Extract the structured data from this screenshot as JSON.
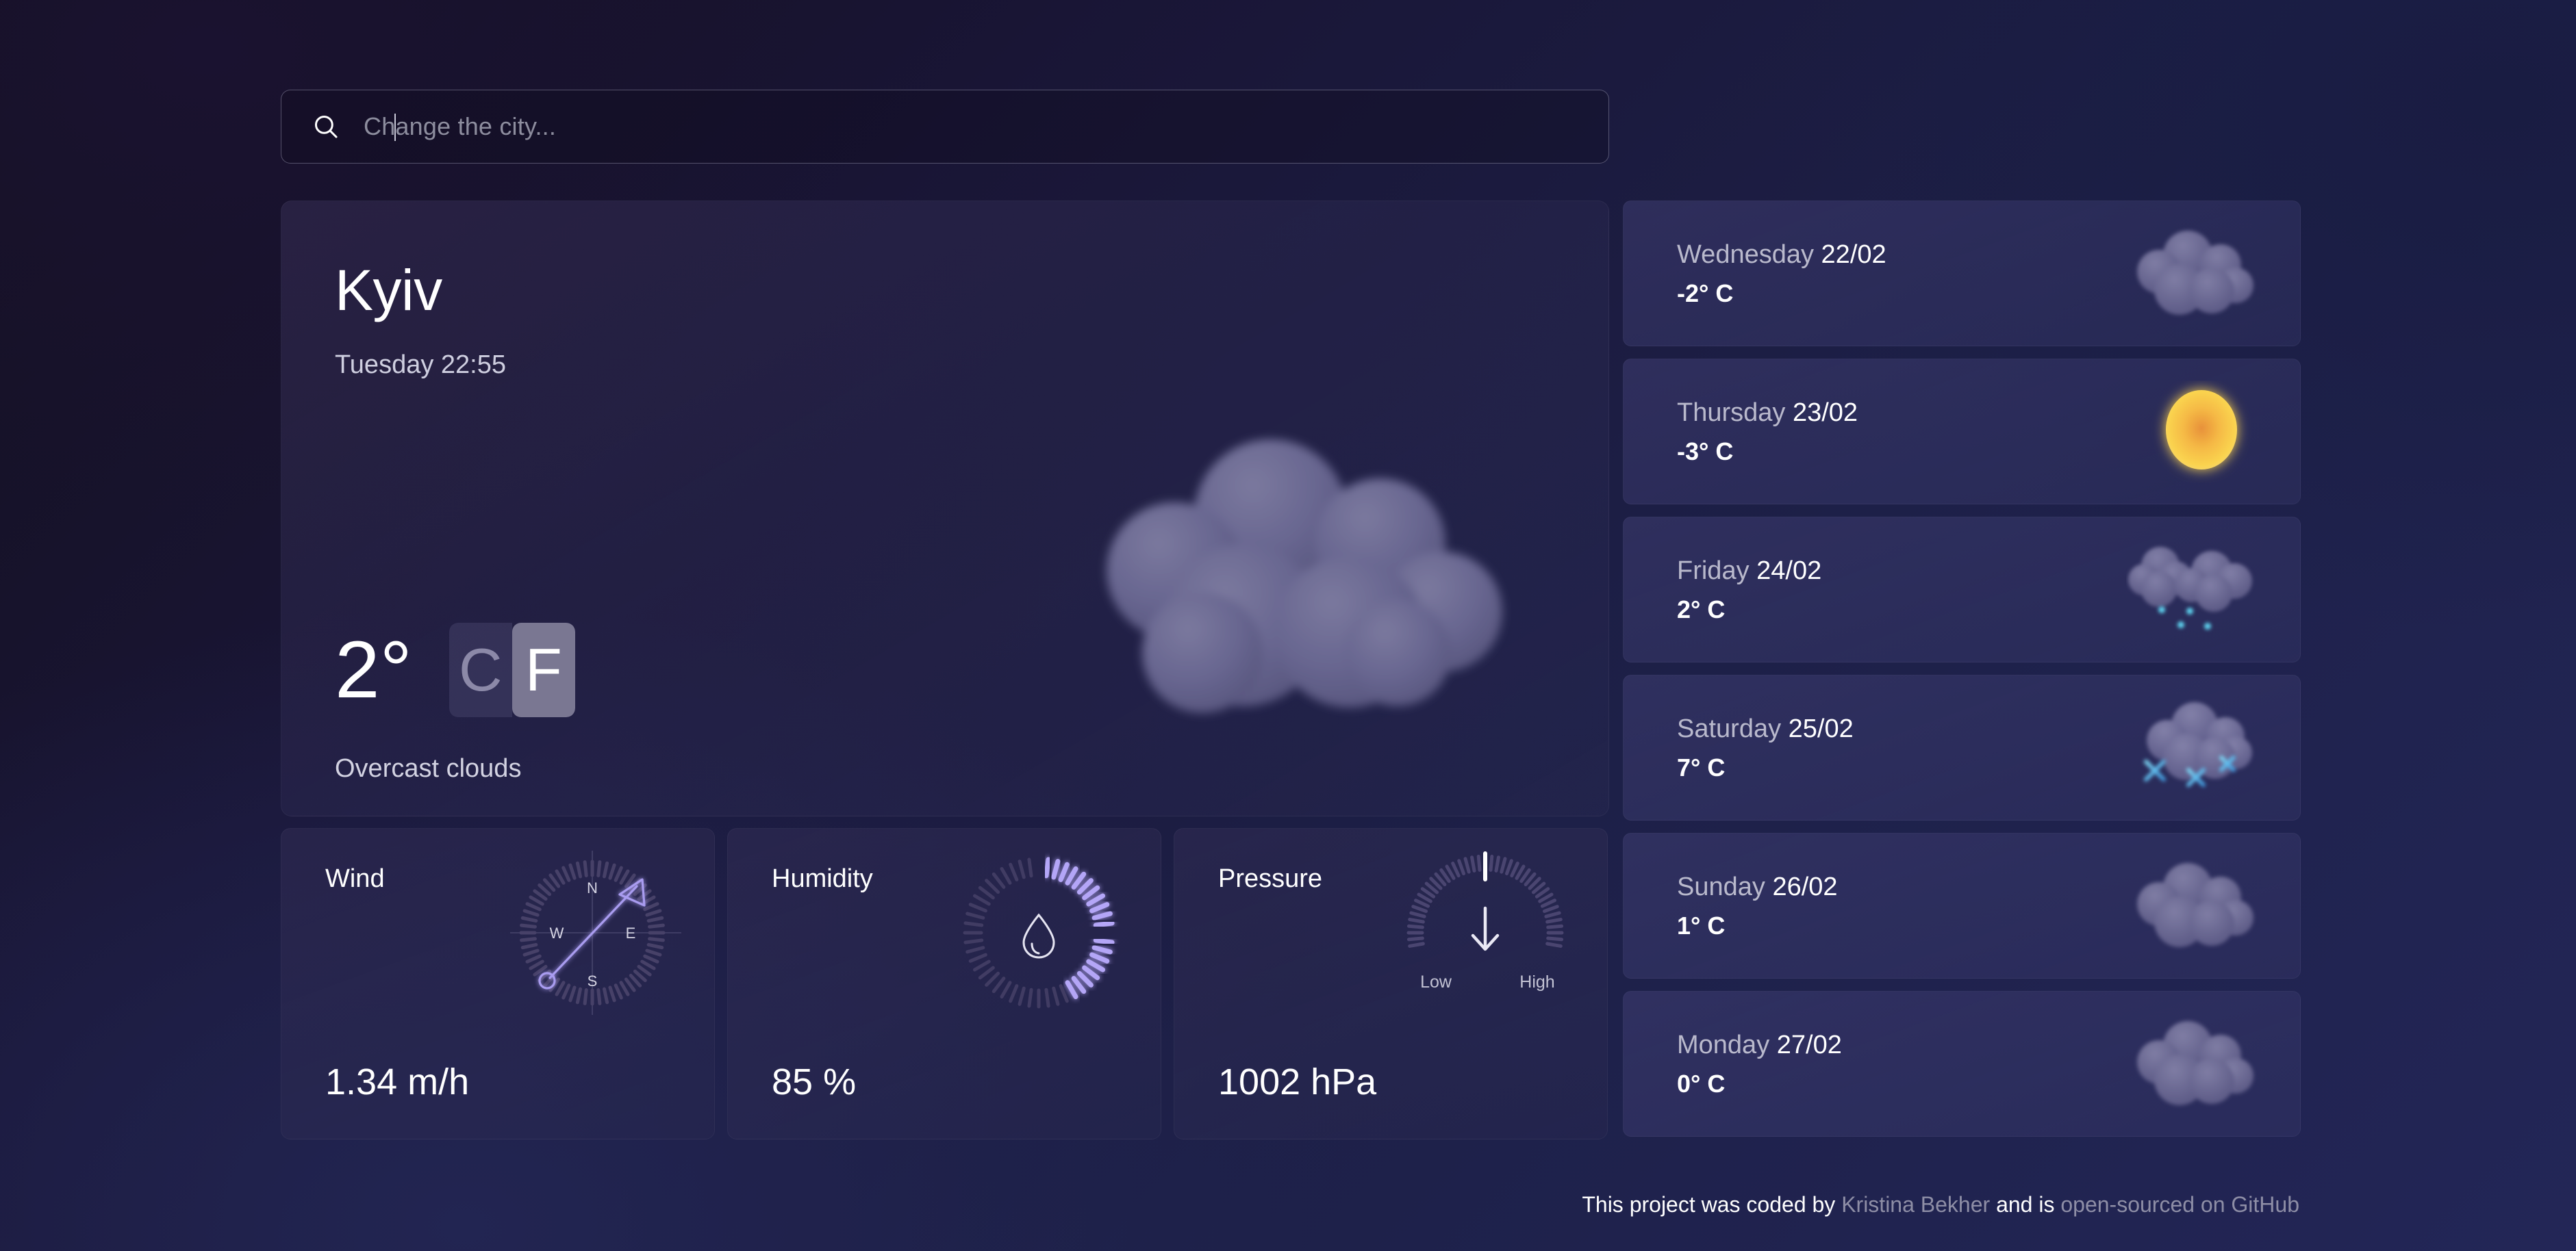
{
  "search": {
    "placeholder": "Change the city...",
    "value": "",
    "icon": "search-icon"
  },
  "current": {
    "city": "Kyiv",
    "date_time": "Tuesday 22:55",
    "temperature": "2°",
    "description": "Overcast clouds",
    "icon": "overcast-clouds-icon",
    "units": {
      "celsius_label": "C",
      "fahrenheit_label": "F",
      "active": "F"
    }
  },
  "forecast": [
    {
      "day": "Wednesday",
      "date": "22/02",
      "temp": "-2° C",
      "icon": "cloud-icon"
    },
    {
      "day": "Thursday",
      "date": "23/02",
      "temp": "-3° C",
      "icon": "sun-icon"
    },
    {
      "day": "Friday",
      "date": "24/02",
      "temp": "2° C",
      "icon": "rain-icon"
    },
    {
      "day": "Saturday",
      "date": "25/02",
      "temp": "7° C",
      "icon": "snow-icon"
    },
    {
      "day": "Sunday",
      "date": "26/02",
      "temp": "1° C",
      "icon": "cloud-icon"
    },
    {
      "day": "Monday",
      "date": "27/02",
      "temp": "0° C",
      "icon": "cloud-icon"
    }
  ],
  "widgets": {
    "wind": {
      "title": "Wind",
      "value": "1.34 m/h",
      "compass": {
        "north": "N",
        "east": "E",
        "south": "S",
        "west": "W"
      },
      "icon": "compass-icon"
    },
    "humidity": {
      "title": "Humidity",
      "value": "85 %",
      "icon": "water-drop-icon"
    },
    "pressure": {
      "title": "Pressure",
      "value": "1002 hPa",
      "low_label": "Low",
      "high_label": "High",
      "icon": "down-arrow-icon"
    }
  },
  "footer": {
    "prefix": "This project was coded by",
    "author": "Kristina Bekher",
    "middle": "and is",
    "link": "open-sourced on GitHub"
  },
  "colors": {
    "accent_purple": "#a99cf0",
    "sun_yellow": "#fad34f",
    "rain_blue": "#5ec8f0",
    "cloud_gray": "#6a6890",
    "active_toggle": "#7a7792"
  }
}
